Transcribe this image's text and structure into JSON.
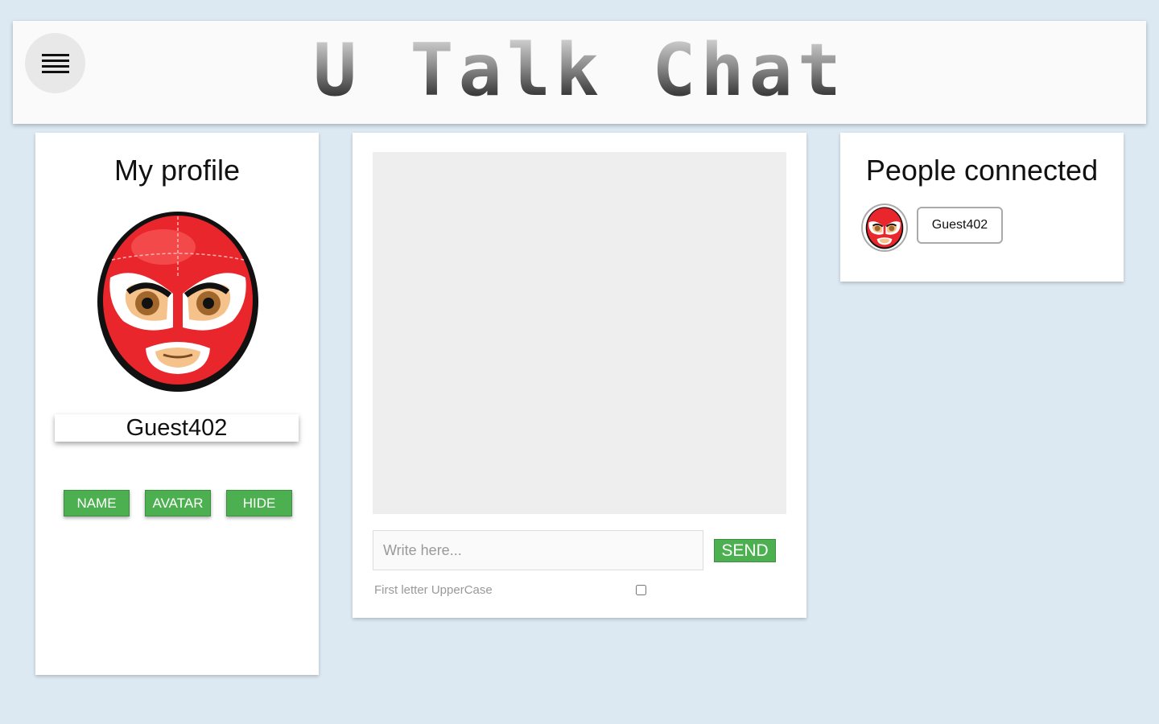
{
  "header": {
    "logo_text": "U Talk Chat",
    "menu_icon": "hamburger-icon"
  },
  "profile": {
    "title": "My profile",
    "avatar_icon": "wrestler-mask-icon",
    "username": "Guest402",
    "buttons": {
      "name": "NAME",
      "avatar": "AVATAR",
      "hide": "HIDE"
    }
  },
  "chat": {
    "input_placeholder": "Write here...",
    "input_value": "",
    "send_label": "SEND",
    "uppercase_label": "First letter UpperCase"
  },
  "people": {
    "title": "People connected",
    "users": [
      {
        "name": "Guest402",
        "avatar_icon": "wrestler-mask-icon"
      }
    ]
  },
  "colors": {
    "background": "#dce8f2",
    "accent_green": "#4caf50",
    "mask_red": "#e8262b"
  }
}
